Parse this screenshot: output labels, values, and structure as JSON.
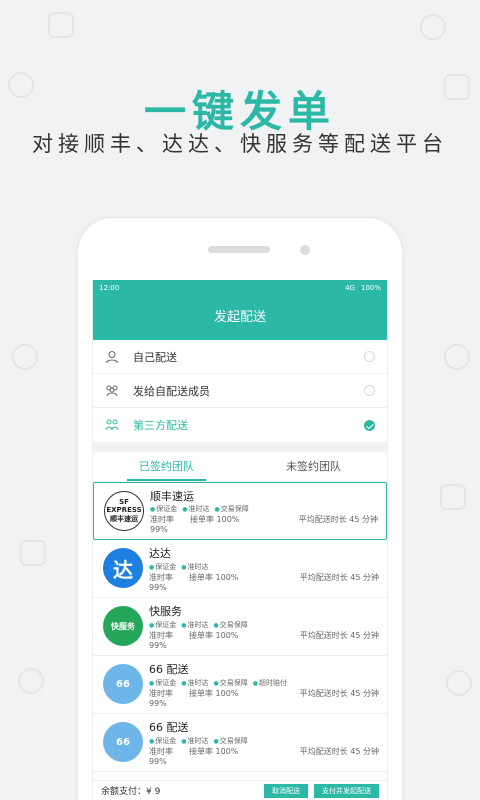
{
  "promo": {
    "headline": "一键发单",
    "subline": "对接顺丰、达达、快服务等配送平台"
  },
  "statusbar": {
    "time": "12:00",
    "network": "4G",
    "battery": "100%"
  },
  "appbar": {
    "title": "发起配送"
  },
  "options": [
    {
      "label": "自己配送",
      "selected": false,
      "icon": "user-icon"
    },
    {
      "label": "发给自配送成员",
      "selected": false,
      "icon": "team-icon"
    },
    {
      "label": "第三方配送",
      "selected": true,
      "icon": "partner-icon"
    }
  ],
  "tabs": [
    {
      "label": "已签约团队",
      "active": true
    },
    {
      "label": "未签约团队",
      "active": false
    }
  ],
  "providers": [
    {
      "name": "顺丰速运",
      "logo": "SF EXPRESS 顺丰速运",
      "tags": [
        "保证金",
        "准时达",
        "交易保障"
      ],
      "ontime": "准时率 99%",
      "accept": "接单率 100%",
      "avg": "平均配送时长 45 分钟"
    },
    {
      "name": "达达",
      "logo": "达",
      "tags": [
        "保证金",
        "准时达"
      ],
      "ontime": "准时率 99%",
      "accept": "接单率 100%",
      "avg": "平均配送时长 45 分钟"
    },
    {
      "name": "快服务",
      "logo": "快服务",
      "tags": [
        "保证金",
        "准时达",
        "交易保障"
      ],
      "ontime": "准时率 99%",
      "accept": "接单率 100%",
      "avg": "平均配送时长 45 分钟"
    },
    {
      "name": "66 配送",
      "logo": "66",
      "tags": [
        "保证金",
        "准时达",
        "交易保障",
        "超时赔付"
      ],
      "ontime": "准时率 99%",
      "accept": "接单率 100%",
      "avg": "平均配送时长 45 分钟"
    },
    {
      "name": "66 配送",
      "logo": "66",
      "tags": [
        "保证金",
        "准时达",
        "交易保障"
      ],
      "ontime": "准时率 99%",
      "accept": "接单率 100%",
      "avg": "平均配送时长 45 分钟"
    }
  ],
  "footer": {
    "amount": "余额支付：¥ 9",
    "cancel_label": "取消配送",
    "pay_label": "支付并发起配送"
  },
  "colors": {
    "accent": "#2bb8a6"
  }
}
